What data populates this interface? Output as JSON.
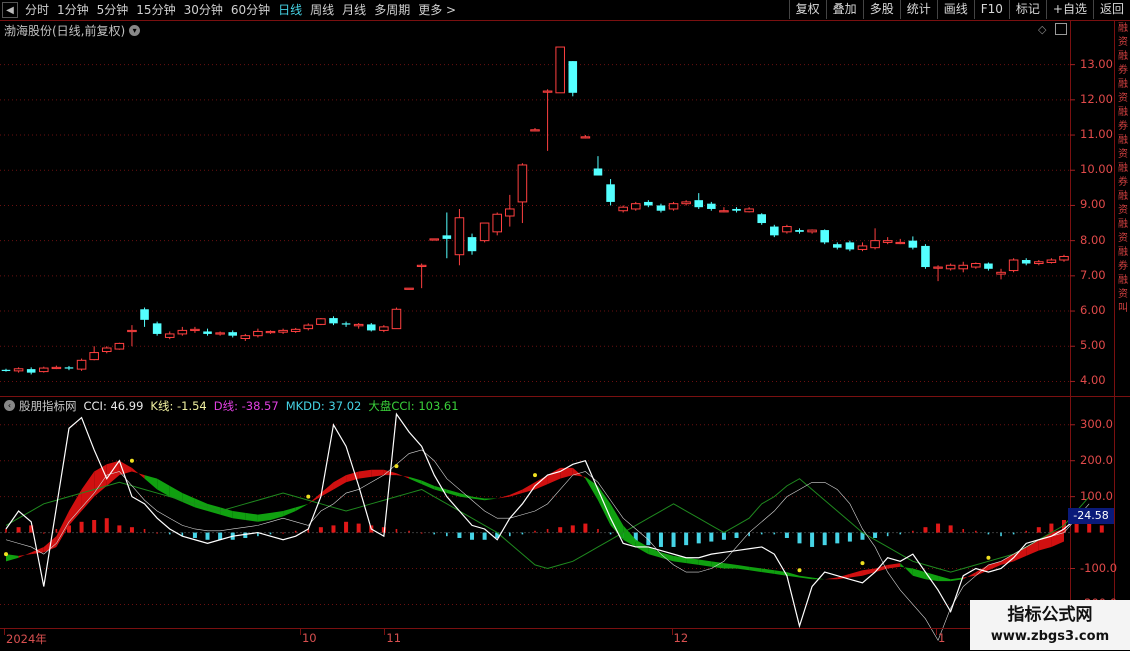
{
  "toolbar": {
    "periods": [
      "分时",
      "1分钟",
      "5分钟",
      "15分钟",
      "30分钟",
      "60分钟",
      "日线",
      "周线",
      "月线",
      "多周期",
      "更多 >"
    ],
    "selected_period": "日线",
    "right_buttons": [
      "复权",
      "叠加",
      "多股",
      "统计",
      "画线",
      "F10",
      "标记",
      "+自选",
      "返回"
    ]
  },
  "main_chart": {
    "title": "渤海股份(日线,前复权)",
    "y_ticks": [
      "13.00",
      "12.00",
      "11.00",
      "10.00",
      "9.00",
      "8.00",
      "7.00",
      "6.00",
      "5.00",
      "4.00"
    ],
    "right_strip_text": "融资融券融资融券融资融券融资 融资融券融资 叫"
  },
  "indicator": {
    "name": "股朋指标网",
    "cci": "CCI: 46.99",
    "k": "K线: -1.54",
    "d": "D线: -38.57",
    "mkdd": "MKDD: 37.02",
    "dapan": "大盘CCI: 103.61",
    "y_ticks": [
      "300.0",
      "200.0",
      "100.0",
      "-100.0",
      "-200.0"
    ],
    "current_value": "-24.58",
    "colors": {
      "cci": "#e8e8e8",
      "k": "#e8e8e8",
      "d": "#e040e0",
      "mkdd": "#46d4e6",
      "dapan": "#3ad03a"
    }
  },
  "x_axis": {
    "labels": [
      {
        "text": "2024年",
        "key": "y"
      },
      {
        "text": "10",
        "key": "m10"
      },
      {
        "text": "11",
        "key": "m11"
      },
      {
        "text": "12",
        "key": "m12"
      },
      {
        "text": "1",
        "key": "m1"
      }
    ]
  },
  "watermark": {
    "line1": "指标公式网",
    "line2": "www.zbgs3.com"
  },
  "chart_data": {
    "type": "candlestick",
    "title": "渤海股份(日线,前复权)",
    "ylim": [
      3.7,
      13.7
    ],
    "candles": [
      {
        "o": 4.33,
        "c": 4.3,
        "h": 4.36,
        "l": 4.28
      },
      {
        "o": 4.3,
        "c": 4.36,
        "h": 4.4,
        "l": 4.25
      },
      {
        "o": 4.35,
        "c": 4.25,
        "h": 4.4,
        "l": 4.2
      },
      {
        "o": 4.28,
        "c": 4.38,
        "h": 4.42,
        "l": 4.25
      },
      {
        "o": 4.38,
        "c": 4.4,
        "h": 4.45,
        "l": 4.35
      },
      {
        "o": 4.4,
        "c": 4.38,
        "h": 4.44,
        "l": 4.32
      },
      {
        "o": 4.35,
        "c": 4.6,
        "h": 4.65,
        "l": 4.3
      },
      {
        "o": 4.62,
        "c": 4.82,
        "h": 5.0,
        "l": 4.6
      },
      {
        "o": 4.85,
        "c": 4.95,
        "h": 5.0,
        "l": 4.8
      },
      {
        "o": 4.92,
        "c": 5.08,
        "h": 5.1,
        "l": 4.9
      },
      {
        "o": 5.45,
        "c": 5.45,
        "h": 5.6,
        "l": 5.0
      },
      {
        "o": 6.05,
        "c": 5.75,
        "h": 6.1,
        "l": 5.55
      },
      {
        "o": 5.65,
        "c": 5.35,
        "h": 5.7,
        "l": 5.3
      },
      {
        "o": 5.25,
        "c": 5.35,
        "h": 5.42,
        "l": 5.2
      },
      {
        "o": 5.35,
        "c": 5.45,
        "h": 5.55,
        "l": 5.3
      },
      {
        "o": 5.45,
        "c": 5.48,
        "h": 5.55,
        "l": 5.38
      },
      {
        "o": 5.42,
        "c": 5.35,
        "h": 5.5,
        "l": 5.3
      },
      {
        "o": 5.35,
        "c": 5.38,
        "h": 5.42,
        "l": 5.3
      },
      {
        "o": 5.4,
        "c": 5.3,
        "h": 5.45,
        "l": 5.25
      },
      {
        "o": 5.22,
        "c": 5.3,
        "h": 5.35,
        "l": 5.15
      },
      {
        "o": 5.3,
        "c": 5.42,
        "h": 5.5,
        "l": 5.25
      },
      {
        "o": 5.4,
        "c": 5.42,
        "h": 5.45,
        "l": 5.35
      },
      {
        "o": 5.4,
        "c": 5.45,
        "h": 5.5,
        "l": 5.35
      },
      {
        "o": 5.42,
        "c": 5.48,
        "h": 5.52,
        "l": 5.38
      },
      {
        "o": 5.5,
        "c": 5.6,
        "h": 5.65,
        "l": 5.45
      },
      {
        "o": 5.62,
        "c": 5.78,
        "h": 5.8,
        "l": 5.6
      },
      {
        "o": 5.8,
        "c": 5.65,
        "h": 5.85,
        "l": 5.6
      },
      {
        "o": 5.65,
        "c": 5.62,
        "h": 5.7,
        "l": 5.55
      },
      {
        "o": 5.58,
        "c": 5.62,
        "h": 5.66,
        "l": 5.5
      },
      {
        "o": 5.62,
        "c": 5.45,
        "h": 5.66,
        "l": 5.42
      },
      {
        "o": 5.45,
        "c": 5.55,
        "h": 5.6,
        "l": 5.4
      },
      {
        "o": 5.5,
        "c": 6.05,
        "h": 6.1,
        "l": 5.5
      },
      {
        "o": 6.65,
        "c": 6.65,
        "h": 6.65,
        "l": 6.65
      },
      {
        "o": 7.3,
        "c": 7.3,
        "h": 7.35,
        "l": 6.65
      },
      {
        "o": 8.05,
        "c": 8.05,
        "h": 8.05,
        "l": 8.05
      },
      {
        "o": 8.15,
        "c": 8.05,
        "h": 8.8,
        "l": 7.5
      },
      {
        "o": 7.6,
        "c": 8.65,
        "h": 8.9,
        "l": 7.3
      },
      {
        "o": 8.1,
        "c": 7.7,
        "h": 8.2,
        "l": 7.6
      },
      {
        "o": 8.0,
        "c": 8.5,
        "h": 8.5,
        "l": 7.95
      },
      {
        "o": 8.25,
        "c": 8.75,
        "h": 8.8,
        "l": 8.15
      },
      {
        "o": 8.7,
        "c": 8.9,
        "h": 9.3,
        "l": 8.4
      },
      {
        "o": 9.1,
        "c": 10.15,
        "h": 10.2,
        "l": 8.5
      },
      {
        "o": 11.15,
        "c": 11.15,
        "h": 11.2,
        "l": 11.1
      },
      {
        "o": 12.25,
        "c": 12.25,
        "h": 12.3,
        "l": 10.55
      },
      {
        "o": 12.2,
        "c": 13.5,
        "h": 13.5,
        "l": 12.2
      },
      {
        "o": 13.1,
        "c": 12.2,
        "h": 13.1,
        "l": 12.1
      },
      {
        "o": 10.95,
        "c": 10.95,
        "h": 11.0,
        "l": 10.9
      },
      {
        "o": 10.05,
        "c": 9.85,
        "h": 10.4,
        "l": 9.85
      },
      {
        "o": 9.6,
        "c": 9.1,
        "h": 9.75,
        "l": 9.0
      },
      {
        "o": 8.85,
        "c": 8.95,
        "h": 9.0,
        "l": 8.8
      },
      {
        "o": 8.9,
        "c": 9.05,
        "h": 9.1,
        "l": 8.85
      },
      {
        "o": 9.1,
        "c": 9.0,
        "h": 9.15,
        "l": 8.95
      },
      {
        "o": 9.0,
        "c": 8.85,
        "h": 9.05,
        "l": 8.8
      },
      {
        "o": 8.9,
        "c": 9.05,
        "h": 9.1,
        "l": 8.85
      },
      {
        "o": 9.05,
        "c": 9.1,
        "h": 9.15,
        "l": 9.0
      },
      {
        "o": 9.15,
        "c": 8.95,
        "h": 9.35,
        "l": 8.9
      },
      {
        "o": 9.05,
        "c": 8.9,
        "h": 9.1,
        "l": 8.85
      },
      {
        "o": 8.85,
        "c": 8.85,
        "h": 8.95,
        "l": 8.8
      },
      {
        "o": 8.9,
        "c": 8.85,
        "h": 8.95,
        "l": 8.8
      },
      {
        "o": 8.82,
        "c": 8.9,
        "h": 8.95,
        "l": 8.8
      },
      {
        "o": 8.75,
        "c": 8.5,
        "h": 8.78,
        "l": 8.45
      },
      {
        "o": 8.4,
        "c": 8.15,
        "h": 8.45,
        "l": 8.1
      },
      {
        "o": 8.25,
        "c": 8.4,
        "h": 8.45,
        "l": 8.2
      },
      {
        "o": 8.3,
        "c": 8.25,
        "h": 8.35,
        "l": 8.2
      },
      {
        "o": 8.25,
        "c": 8.3,
        "h": 8.32,
        "l": 8.2
      },
      {
        "o": 8.3,
        "c": 7.95,
        "h": 8.32,
        "l": 7.9
      },
      {
        "o": 7.9,
        "c": 7.8,
        "h": 7.95,
        "l": 7.75
      },
      {
        "o": 7.95,
        "c": 7.75,
        "h": 8.0,
        "l": 7.7
      },
      {
        "o": 7.75,
        "c": 7.85,
        "h": 7.95,
        "l": 7.7
      },
      {
        "o": 7.8,
        "c": 8.0,
        "h": 8.35,
        "l": 7.75
      },
      {
        "o": 7.95,
        "c": 8.0,
        "h": 8.1,
        "l": 7.9
      },
      {
        "o": 7.95,
        "c": 7.95,
        "h": 8.05,
        "l": 7.9
      },
      {
        "o": 8.0,
        "c": 7.8,
        "h": 8.12,
        "l": 7.75
      },
      {
        "o": 7.85,
        "c": 7.25,
        "h": 7.9,
        "l": 7.2
      },
      {
        "o": 7.25,
        "c": 7.25,
        "h": 7.3,
        "l": 6.85
      },
      {
        "o": 7.2,
        "c": 7.3,
        "h": 7.35,
        "l": 7.15
      },
      {
        "o": 7.2,
        "c": 7.3,
        "h": 7.4,
        "l": 7.1
      },
      {
        "o": 7.25,
        "c": 7.35,
        "h": 7.38,
        "l": 7.2
      },
      {
        "o": 7.35,
        "c": 7.2,
        "h": 7.38,
        "l": 7.15
      },
      {
        "o": 7.05,
        "c": 7.1,
        "h": 7.2,
        "l": 6.9
      },
      {
        "o": 7.15,
        "c": 7.45,
        "h": 7.5,
        "l": 7.1
      },
      {
        "o": 7.45,
        "c": 7.35,
        "h": 7.5,
        "l": 7.3
      },
      {
        "o": 7.35,
        "c": 7.4,
        "h": 7.45,
        "l": 7.3
      },
      {
        "o": 7.38,
        "c": 7.45,
        "h": 7.5,
        "l": 7.35
      },
      {
        "o": 7.45,
        "c": 7.55,
        "h": 7.6,
        "l": 7.4
      }
    ],
    "indicator_ylim": [
      -260,
      330
    ],
    "cci_white": [
      10,
      60,
      30,
      -150,
      70,
      290,
      320,
      230,
      150,
      200,
      100,
      80,
      40,
      10,
      -10,
      -20,
      -30,
      -20,
      -10,
      -5,
      0,
      -10,
      -20,
      -10,
      10,
      100,
      300,
      240,
      130,
      10,
      -10,
      330,
      280,
      240,
      160,
      100,
      60,
      20,
      10,
      -20,
      40,
      80,
      130,
      160,
      170,
      190,
      200,
      120,
      40,
      -30,
      -40,
      -40,
      -50,
      -60,
      -70,
      -70,
      -60,
      -55,
      -50,
      -45,
      -40,
      -60,
      -120,
      -260,
      -150,
      -110,
      -120,
      -130,
      -140,
      -110,
      -70,
      -80,
      -60,
      -110,
      -160,
      -220,
      -120,
      -100,
      -110,
      -100,
      -70,
      -30,
      -20,
      -10,
      10,
      40,
      60
    ],
    "d_line": [
      -20,
      -30,
      -40,
      -60,
      -30,
      30,
      70,
      110,
      160,
      170,
      130,
      90,
      60,
      40,
      20,
      10,
      5,
      5,
      10,
      15,
      20,
      30,
      40,
      30,
      20,
      60,
      80,
      110,
      120,
      140,
      160,
      190,
      220,
      230,
      200,
      150,
      120,
      90,
      60,
      40,
      40,
      50,
      60,
      80,
      120,
      160,
      170,
      140,
      90,
      40,
      10,
      -20,
      -60,
      -90,
      -110,
      -110,
      -100,
      -80,
      -40,
      0,
      30,
      60,
      100,
      120,
      140,
      140,
      120,
      80,
      10,
      -40,
      -110,
      -160,
      -200,
      -240,
      -300,
      -210,
      -150,
      -120,
      -90,
      -80,
      -60,
      -40,
      -20,
      -10,
      0,
      40,
      80
    ],
    "band_fast": [
      -80,
      -70,
      -55,
      -40,
      -10,
      60,
      120,
      170,
      190,
      200,
      180,
      150,
      120,
      100,
      85,
      70,
      60,
      50,
      40,
      35,
      30,
      35,
      45,
      60,
      80,
      110,
      140,
      160,
      170,
      175,
      175,
      165,
      150,
      135,
      120,
      110,
      100,
      95,
      90,
      95,
      105,
      120,
      140,
      160,
      180,
      180,
      150,
      90,
      20,
      -20,
      -40,
      -60,
      -70,
      -80,
      -85,
      -90,
      -95,
      -100,
      -100,
      -105,
      -110,
      -115,
      -120,
      -125,
      -130,
      -130,
      -125,
      -115,
      -105,
      -100,
      -90,
      -85,
      -120,
      -130,
      -135,
      -135,
      -130,
      -110,
      -90,
      -80,
      -60,
      -40,
      -20,
      0,
      10,
      20,
      30
    ],
    "band_slow": [
      -60,
      -65,
      -60,
      -55,
      -40,
      20,
      60,
      100,
      130,
      160,
      170,
      160,
      150,
      130,
      110,
      95,
      80,
      70,
      60,
      55,
      50,
      55,
      60,
      70,
      80,
      100,
      120,
      140,
      150,
      155,
      160,
      160,
      155,
      145,
      130,
      120,
      110,
      100,
      95,
      95,
      100,
      110,
      120,
      135,
      150,
      160,
      155,
      130,
      80,
      20,
      -20,
      -40,
      -55,
      -65,
      -70,
      -75,
      -80,
      -85,
      -90,
      -95,
      -100,
      -105,
      -110,
      -120,
      -125,
      -130,
      -130,
      -125,
      -120,
      -110,
      -100,
      -95,
      -100,
      -110,
      -120,
      -130,
      -125,
      -120,
      -105,
      -90,
      -80,
      -65,
      -50,
      -40,
      -25,
      -10,
      0
    ],
    "histogram": [
      10,
      15,
      20,
      0,
      10,
      20,
      30,
      35,
      40,
      20,
      15,
      10,
      0,
      -5,
      -10,
      -15,
      -20,
      -20,
      -20,
      -15,
      -10,
      -5,
      0,
      5,
      10,
      15,
      20,
      30,
      25,
      20,
      15,
      10,
      5,
      0,
      -5,
      -10,
      -15,
      -20,
      -20,
      -15,
      -10,
      -5,
      5,
      10,
      15,
      20,
      25,
      10,
      -5,
      -15,
      -25,
      -35,
      -40,
      -40,
      -35,
      -30,
      -25,
      -20,
      -15,
      -10,
      -5,
      -5,
      -15,
      -30,
      -40,
      -35,
      -30,
      -25,
      -20,
      -15,
      -10,
      -5,
      5,
      15,
      25,
      20,
      10,
      5,
      -5,
      -10,
      -5,
      5,
      15,
      25,
      35,
      40,
      45,
      20
    ],
    "dapan": [
      20,
      40,
      60,
      80,
      90,
      100,
      110,
      120,
      130,
      140,
      130,
      120,
      110,
      100,
      90,
      80,
      70,
      60,
      70,
      80,
      90,
      100,
      110,
      100,
      90,
      80,
      70,
      60,
      70,
      80,
      90,
      100,
      110,
      120,
      100,
      80,
      60,
      40,
      20,
      0,
      -30,
      -60,
      -90,
      -100,
      -90,
      -80,
      -60,
      -40,
      -20,
      0,
      20,
      40,
      60,
      80,
      60,
      40,
      20,
      0,
      20,
      40,
      80,
      100,
      130,
      150,
      120,
      90,
      60,
      30,
      0,
      -20,
      -40,
      -60,
      -80,
      -90,
      -100,
      -110,
      -100,
      -90,
      -80,
      -70,
      -60,
      -40,
      -20,
      0,
      20,
      60,
      100
    ]
  }
}
